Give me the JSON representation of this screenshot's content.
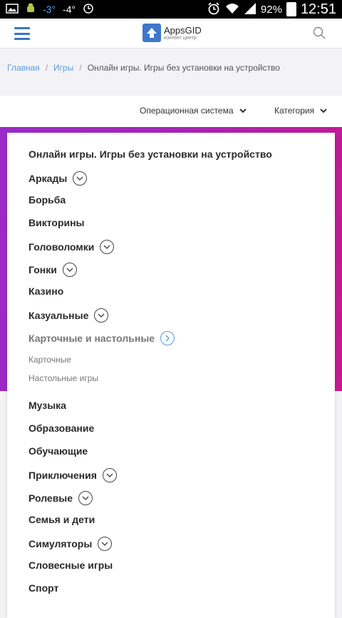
{
  "status_bar": {
    "temp1": "-3°",
    "temp2": "-4°",
    "battery": "92%",
    "time": "12:51"
  },
  "header": {
    "logo_name": "AppsGID",
    "logo_sub": "контент центр"
  },
  "breadcrumb": {
    "home": "Главная",
    "games": "Игры",
    "current": "Онлайн игры. Игры без установки на устройство"
  },
  "filters": {
    "os": "Операционная система",
    "category": "Категория"
  },
  "menu": {
    "title": "Онлайн игры. Игры без установки на устройство",
    "items": [
      "Аркады",
      "Борьба",
      "Викторины",
      "Головоломки",
      "Гонки",
      "Казино",
      "Казуальные",
      "Карточные и настольные",
      "Карточные",
      "Настольные игры",
      "Музыка",
      "Образование",
      "Обучающие",
      "Приключения",
      "Ролевые",
      "Семья и дети",
      "Симуляторы",
      "Словесные игры",
      "Спорт"
    ]
  },
  "colors": {
    "accent": "#3d78c9",
    "link": "#5b9be0",
    "gradient_start": "#9a2bc7",
    "gradient_end": "#c8178f"
  },
  "icons": [
    "menu-icon",
    "logo-arrow-icon",
    "search-icon",
    "chevron-down-icon",
    "chevron-right-icon"
  ]
}
